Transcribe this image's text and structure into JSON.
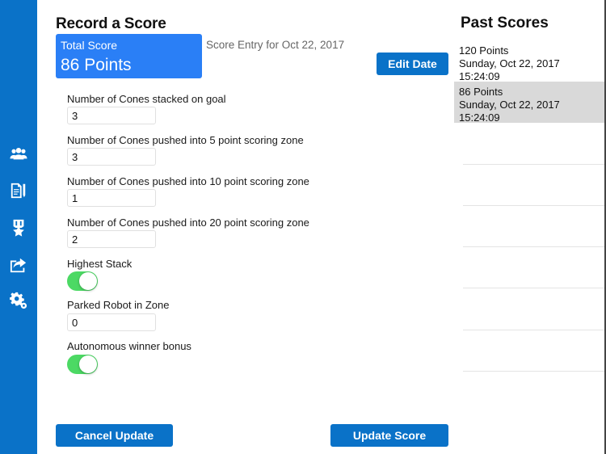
{
  "sidebar": {
    "items": [
      {
        "icon": "team-icon",
        "label": "Teams"
      },
      {
        "icon": "document-edit-icon",
        "label": "Scoresheet"
      },
      {
        "icon": "award-icon",
        "label": "Awards"
      },
      {
        "icon": "share-icon",
        "label": "Share"
      },
      {
        "icon": "settings-icon",
        "label": "Settings"
      }
    ]
  },
  "main": {
    "title": "Record a Score",
    "total_score": {
      "label": "Total Score",
      "value": "86 Points"
    },
    "entry_date": "Score Entry for Oct 22, 2017",
    "edit_date_label": "Edit Date",
    "fields": [
      {
        "label": "Number of Cones stacked on goal",
        "value": "3"
      },
      {
        "label": "Number of Cones pushed into 5 point scoring zone",
        "value": "3"
      },
      {
        "label": "Number of Cones pushed into 10 point scoring zone",
        "value": "1"
      },
      {
        "label": "Number of Cones pushed into 20 point scoring zone",
        "value": "2"
      }
    ],
    "highest_stack": {
      "label": "Highest Stack",
      "on": true
    },
    "parked_robot": {
      "label": "Parked Robot in Zone",
      "value": "0"
    },
    "autonomous_bonus": {
      "label": "Autonomous winner bonus",
      "on": true
    },
    "cancel_label": "Cancel Update",
    "update_label": "Update Score"
  },
  "past_scores": {
    "title": "Past Scores",
    "items": [
      {
        "points": "120 Points",
        "date": "Sunday, Oct 22, 2017 15:24:09",
        "selected": false
      },
      {
        "points": "86 Points",
        "date": "Sunday, Oct 22, 2017 15:24:09",
        "selected": true
      }
    ]
  },
  "colors": {
    "sidebar": "#0a72c8",
    "score_box": "#2a7ff6",
    "toggle_on": "#4cd964",
    "selected_row": "#d9d9d9"
  }
}
